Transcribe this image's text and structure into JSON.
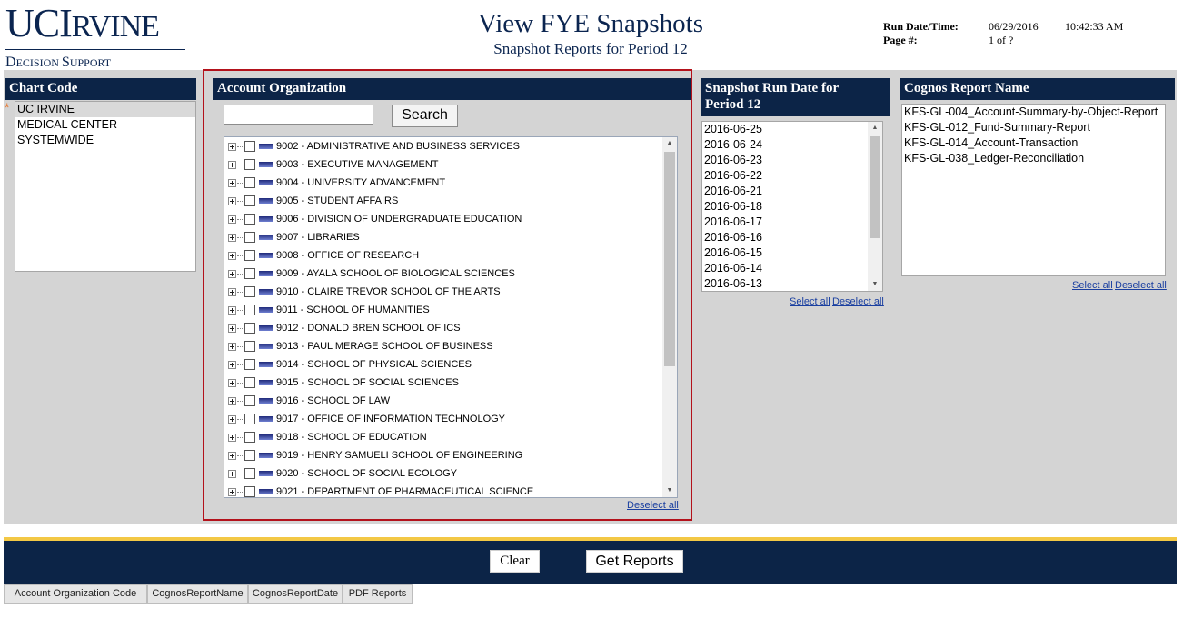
{
  "header": {
    "logo_main": "UC",
    "logo_main_cap": "I",
    "logo_main_small": "RVINE",
    "logo_sub_cap1": "D",
    "logo_sub_small1": "ECISION ",
    "logo_sub_cap2": "S",
    "logo_sub_small2": "UPPORT",
    "title": "View FYE Snapshots",
    "subtitle": "Snapshot Reports for Period 12",
    "run_datetime_label": "Run Date/Time:",
    "run_date": "06/29/2016",
    "run_time": "10:42:33 AM",
    "page_label": "Page #:",
    "page_value": "1 of ?"
  },
  "chart_code": {
    "title": "Chart Code",
    "required_marker": "*",
    "options": [
      {
        "label": "UC IRVINE",
        "selected": true
      },
      {
        "label": "MEDICAL CENTER",
        "selected": false
      },
      {
        "label": "SYSTEMWIDE",
        "selected": false
      }
    ]
  },
  "account_org": {
    "title": "Account Organization",
    "search_value": "",
    "search_button": "Search",
    "deselect_all": "Deselect all",
    "items": [
      "9002 - ADMINISTRATIVE AND BUSINESS SERVICES",
      "9003 - EXECUTIVE MANAGEMENT",
      "9004 - UNIVERSITY ADVANCEMENT",
      "9005 - STUDENT AFFAIRS",
      "9006 - DIVISION OF UNDERGRADUATE EDUCATION",
      "9007 - LIBRARIES",
      "9008 - OFFICE OF RESEARCH",
      "9009 - AYALA SCHOOL OF BIOLOGICAL SCIENCES",
      "9010 - CLAIRE TREVOR SCHOOL OF THE ARTS",
      "9011 - SCHOOL OF HUMANITIES",
      "9012 - DONALD BREN SCHOOL OF ICS",
      "9013 - PAUL MERAGE SCHOOL OF BUSINESS",
      "9014 - SCHOOL OF PHYSICAL SCIENCES",
      "9015 - SCHOOL OF SOCIAL SCIENCES",
      "9016 - SCHOOL OF LAW",
      "9017 - OFFICE OF INFORMATION TECHNOLOGY",
      "9018 - SCHOOL OF EDUCATION",
      "9019 - HENRY SAMUELI SCHOOL OF ENGINEERING",
      "9020 - SCHOOL OF SOCIAL ECOLOGY",
      "9021 - DEPARTMENT OF PHARMACEUTICAL SCIENCE"
    ]
  },
  "snapshot_dates": {
    "title_line1": "Snapshot Run Date for",
    "title_line2": "Period 12",
    "dates": [
      "2016-06-25",
      "2016-06-24",
      "2016-06-23",
      "2016-06-22",
      "2016-06-21",
      "2016-06-18",
      "2016-06-17",
      "2016-06-16",
      "2016-06-15",
      "2016-06-14",
      "2016-06-13"
    ],
    "select_all": "Select all",
    "deselect_all": "Deselect all"
  },
  "cognos_reports": {
    "title": "Cognos Report Name",
    "reports": [
      "KFS-GL-004_Account-Summary-by-Object-Report",
      "KFS-GL-012_Fund-Summary-Report",
      "KFS-GL-014_Account-Transaction",
      "KFS-GL-038_Ledger-Reconciliation"
    ],
    "select_all": "Select all",
    "deselect_all": "Deselect all"
  },
  "actions": {
    "clear": "Clear",
    "get_reports": "Get Reports"
  },
  "results_table": {
    "columns": [
      "Account Organization Code",
      "CognosReportName",
      "CognosReportDate",
      "PDF Reports"
    ]
  },
  "colors": {
    "navy": "#0c2447",
    "gold": "#f3c845",
    "highlight_border": "#b3121b",
    "panel_gray": "#d4d4d4"
  }
}
